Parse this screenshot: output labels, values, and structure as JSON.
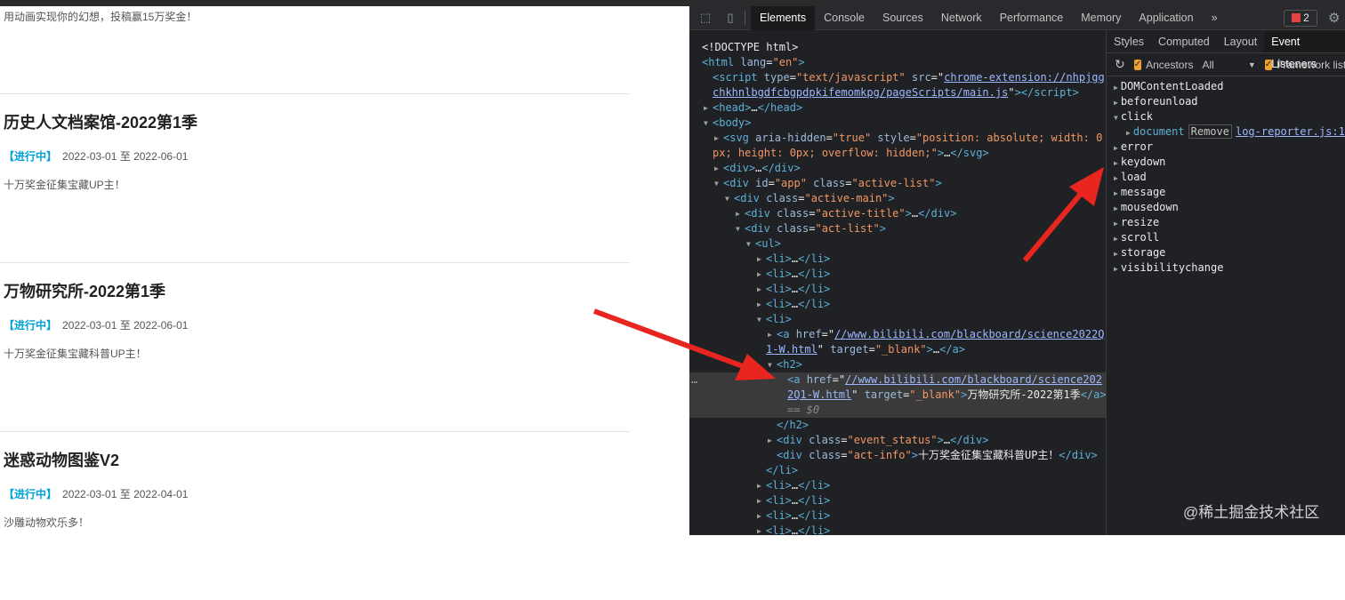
{
  "page": {
    "intro": "用动画实现你的幻想，投稿赢15万奖金！",
    "items": [
      {
        "title": "历史人文档案馆-2022第1季",
        "status": "【进行中】",
        "dates": "2022-03-01 至 2022-06-01",
        "info": "十万奖金征集宝藏UP主！"
      },
      {
        "title": "万物研究所-2022第1季",
        "status": "【进行中】",
        "dates": "2022-03-01 至 2022-06-01",
        "info": "十万奖金征集宝藏科普UP主！"
      },
      {
        "title": "迷惑动物图鉴V2",
        "status": "【进行中】",
        "dates": "2022-03-01 至 2022-04-01",
        "info": "沙雕动物欢乐多！"
      }
    ]
  },
  "devtools": {
    "tabs": [
      "Elements",
      "Console",
      "Sources",
      "Network",
      "Performance",
      "Memory",
      "Application"
    ],
    "more": "»",
    "errors": "2",
    "side_tabs": [
      "Styles",
      "Computed",
      "Layout",
      "Event Listeners"
    ],
    "ancestors": "Ancestors",
    "ancestors_filter": "All",
    "framework": "Framework listeners",
    "events": [
      "DOMContentLoaded",
      "beforeunload",
      "click",
      "error",
      "keydown",
      "load",
      "message",
      "mousedown",
      "resize",
      "scroll",
      "storage",
      "visibilitychange"
    ],
    "listener": {
      "node": "document",
      "remove": "Remove",
      "source": "log-reporter.js:1"
    },
    "dom": [
      {
        "d": 0,
        "a": "",
        "t": [
          [
            "tx",
            "<!DOCTYPE html>"
          ]
        ]
      },
      {
        "d": 0,
        "a": "",
        "t": [
          [
            "tg",
            "<html "
          ],
          [
            "an",
            "lang"
          ],
          [
            "tx",
            "="
          ],
          [
            "av",
            "\"en\""
          ],
          [
            "tg",
            ">"
          ]
        ]
      },
      {
        "d": 1,
        "a": "",
        "t": [
          [
            "tg",
            "<script "
          ],
          [
            "an",
            "type"
          ],
          [
            "tx",
            "="
          ],
          [
            "av",
            "\"text/javascript\""
          ],
          [
            "an",
            " src"
          ],
          [
            "tx",
            "=\""
          ],
          [
            "lk",
            "chrome-extension://nhpjgg"
          ]
        ]
      },
      {
        "d": 1,
        "a": "",
        "t": [
          [
            "lk",
            "chkhnlbgdfcbgpdpkifemomkpg/pageScripts/main.js"
          ],
          [
            "tx",
            "\""
          ],
          [
            "tg",
            "></script>"
          ]
        ]
      },
      {
        "d": 1,
        "a": "▶",
        "t": [
          [
            "tg",
            "<head>"
          ],
          [
            "tx",
            "…"
          ],
          [
            "tg",
            "</head>"
          ]
        ]
      },
      {
        "d": 1,
        "a": "▼",
        "t": [
          [
            "tg",
            "<body>"
          ]
        ]
      },
      {
        "d": 2,
        "a": "▶",
        "t": [
          [
            "tg",
            "<svg "
          ],
          [
            "an",
            "aria-hidden"
          ],
          [
            "tx",
            "="
          ],
          [
            "av",
            "\"true\""
          ],
          [
            "an",
            " style"
          ],
          [
            "tx",
            "="
          ],
          [
            "av",
            "\"position: absolute; width: 0"
          ]
        ]
      },
      {
        "d": 1,
        "a": "",
        "t": [
          [
            "av",
            "px; height: 0px; overflow: hidden;\""
          ],
          [
            "tg",
            ">"
          ],
          [
            "tx",
            "…"
          ],
          [
            "tg",
            "</svg>"
          ]
        ]
      },
      {
        "d": 2,
        "a": "▶",
        "t": [
          [
            "tg",
            "<div>"
          ],
          [
            "tx",
            "…"
          ],
          [
            "tg",
            "</div>"
          ]
        ]
      },
      {
        "d": 2,
        "a": "▼",
        "t": [
          [
            "tg",
            "<div "
          ],
          [
            "an",
            "id"
          ],
          [
            "tx",
            "="
          ],
          [
            "av",
            "\"app\""
          ],
          [
            "an",
            " class"
          ],
          [
            "tx",
            "="
          ],
          [
            "av",
            "\"active-list\""
          ],
          [
            "tg",
            ">"
          ]
        ]
      },
      {
        "d": 3,
        "a": "▼",
        "t": [
          [
            "tg",
            "<div "
          ],
          [
            "an",
            "class"
          ],
          [
            "tx",
            "="
          ],
          [
            "av",
            "\"active-main\""
          ],
          [
            "tg",
            ">"
          ]
        ]
      },
      {
        "d": 4,
        "a": "▶",
        "t": [
          [
            "tg",
            "<div "
          ],
          [
            "an",
            "class"
          ],
          [
            "tx",
            "="
          ],
          [
            "av",
            "\"active-title\""
          ],
          [
            "tg",
            ">"
          ],
          [
            "tx",
            "…"
          ],
          [
            "tg",
            "</div>"
          ]
        ]
      },
      {
        "d": 4,
        "a": "▼",
        "t": [
          [
            "tg",
            "<div "
          ],
          [
            "an",
            "class"
          ],
          [
            "tx",
            "="
          ],
          [
            "av",
            "\"act-list\""
          ],
          [
            "tg",
            ">"
          ]
        ]
      },
      {
        "d": 5,
        "a": "▼",
        "t": [
          [
            "tg",
            "<ul>"
          ]
        ]
      },
      {
        "d": 6,
        "a": "▶",
        "t": [
          [
            "tg",
            "<li>"
          ],
          [
            "tx",
            "…"
          ],
          [
            "tg",
            "</li>"
          ]
        ]
      },
      {
        "d": 6,
        "a": "▶",
        "t": [
          [
            "tg",
            "<li>"
          ],
          [
            "tx",
            "…"
          ],
          [
            "tg",
            "</li>"
          ]
        ]
      },
      {
        "d": 6,
        "a": "▶",
        "t": [
          [
            "tg",
            "<li>"
          ],
          [
            "tx",
            "…"
          ],
          [
            "tg",
            "</li>"
          ]
        ]
      },
      {
        "d": 6,
        "a": "▶",
        "t": [
          [
            "tg",
            "<li>"
          ],
          [
            "tx",
            "…"
          ],
          [
            "tg",
            "</li>"
          ]
        ]
      },
      {
        "d": 6,
        "a": "▼",
        "t": [
          [
            "tg",
            "<li>"
          ]
        ]
      },
      {
        "d": 7,
        "a": "▶",
        "t": [
          [
            "tg",
            "<a "
          ],
          [
            "an",
            "href"
          ],
          [
            "tx",
            "=\""
          ],
          [
            "lk",
            "//www.bilibili.com/blackboard/science2022Q"
          ]
        ]
      },
      {
        "d": 6,
        "a": "",
        "t": [
          [
            "lk",
            "1-W.html"
          ],
          [
            "tx",
            "\""
          ],
          [
            "an",
            " target"
          ],
          [
            "tx",
            "="
          ],
          [
            "av",
            "\"_blank\""
          ],
          [
            "tg",
            ">"
          ],
          [
            "tx",
            "…"
          ],
          [
            "tg",
            "</a>"
          ]
        ]
      },
      {
        "d": 7,
        "a": "▼",
        "t": [
          [
            "tg",
            "<h2>"
          ]
        ]
      },
      {
        "d": 8,
        "a": "",
        "s": 1,
        "t": [
          [
            "tg",
            "<a "
          ],
          [
            "an",
            "href"
          ],
          [
            "tx",
            "=\""
          ],
          [
            "lk",
            "//www.bilibili.com/blackboard/science202"
          ]
        ]
      },
      {
        "d": 8,
        "a": "",
        "s": 1,
        "t": [
          [
            "lk",
            "2Q1-W.html"
          ],
          [
            "tx",
            "\""
          ],
          [
            "an",
            " target"
          ],
          [
            "tx",
            "="
          ],
          [
            "av",
            "\"_blank\""
          ],
          [
            "tg",
            ">"
          ],
          [
            "tx",
            "万物研究所-2022第1季"
          ],
          [
            "tg",
            "</a>"
          ]
        ]
      },
      {
        "d": 8,
        "a": "",
        "s": 1,
        "t": [
          [
            "dm",
            "== $0"
          ]
        ]
      },
      {
        "d": 7,
        "a": "",
        "t": [
          [
            "tg",
            "</h2>"
          ]
        ]
      },
      {
        "d": 7,
        "a": "▶",
        "t": [
          [
            "tg",
            "<div "
          ],
          [
            "an",
            "class"
          ],
          [
            "tx",
            "="
          ],
          [
            "av",
            "\"event_status\""
          ],
          [
            "tg",
            ">"
          ],
          [
            "tx",
            "…"
          ],
          [
            "tg",
            "</div>"
          ]
        ]
      },
      {
        "d": 7,
        "a": "",
        "t": [
          [
            "tg",
            "<div "
          ],
          [
            "an",
            "class"
          ],
          [
            "tx",
            "="
          ],
          [
            "av",
            "\"act-info\""
          ],
          [
            "tg",
            ">"
          ],
          [
            "tx",
            "十万奖金征集宝藏科普UP主！"
          ],
          [
            "tg",
            "</div>"
          ]
        ]
      },
      {
        "d": 6,
        "a": "",
        "t": [
          [
            "tg",
            "</li>"
          ]
        ]
      },
      {
        "d": 6,
        "a": "▶",
        "t": [
          [
            "tg",
            "<li>"
          ],
          [
            "tx",
            "…"
          ],
          [
            "tg",
            "</li>"
          ]
        ]
      },
      {
        "d": 6,
        "a": "▶",
        "t": [
          [
            "tg",
            "<li>"
          ],
          [
            "tx",
            "…"
          ],
          [
            "tg",
            "</li>"
          ]
        ]
      },
      {
        "d": 6,
        "a": "▶",
        "t": [
          [
            "tg",
            "<li>"
          ],
          [
            "tx",
            "…"
          ],
          [
            "tg",
            "</li>"
          ]
        ]
      },
      {
        "d": 6,
        "a": "▶",
        "t": [
          [
            "tg",
            "<li>"
          ],
          [
            "tx",
            "…"
          ],
          [
            "tg",
            "</li>"
          ]
        ]
      }
    ],
    "selected_marker": "…"
  },
  "watermark": "@稀土掘金技术社区",
  "colors": {
    "accent": "#00a1d6",
    "arrow": "#e8261f"
  }
}
